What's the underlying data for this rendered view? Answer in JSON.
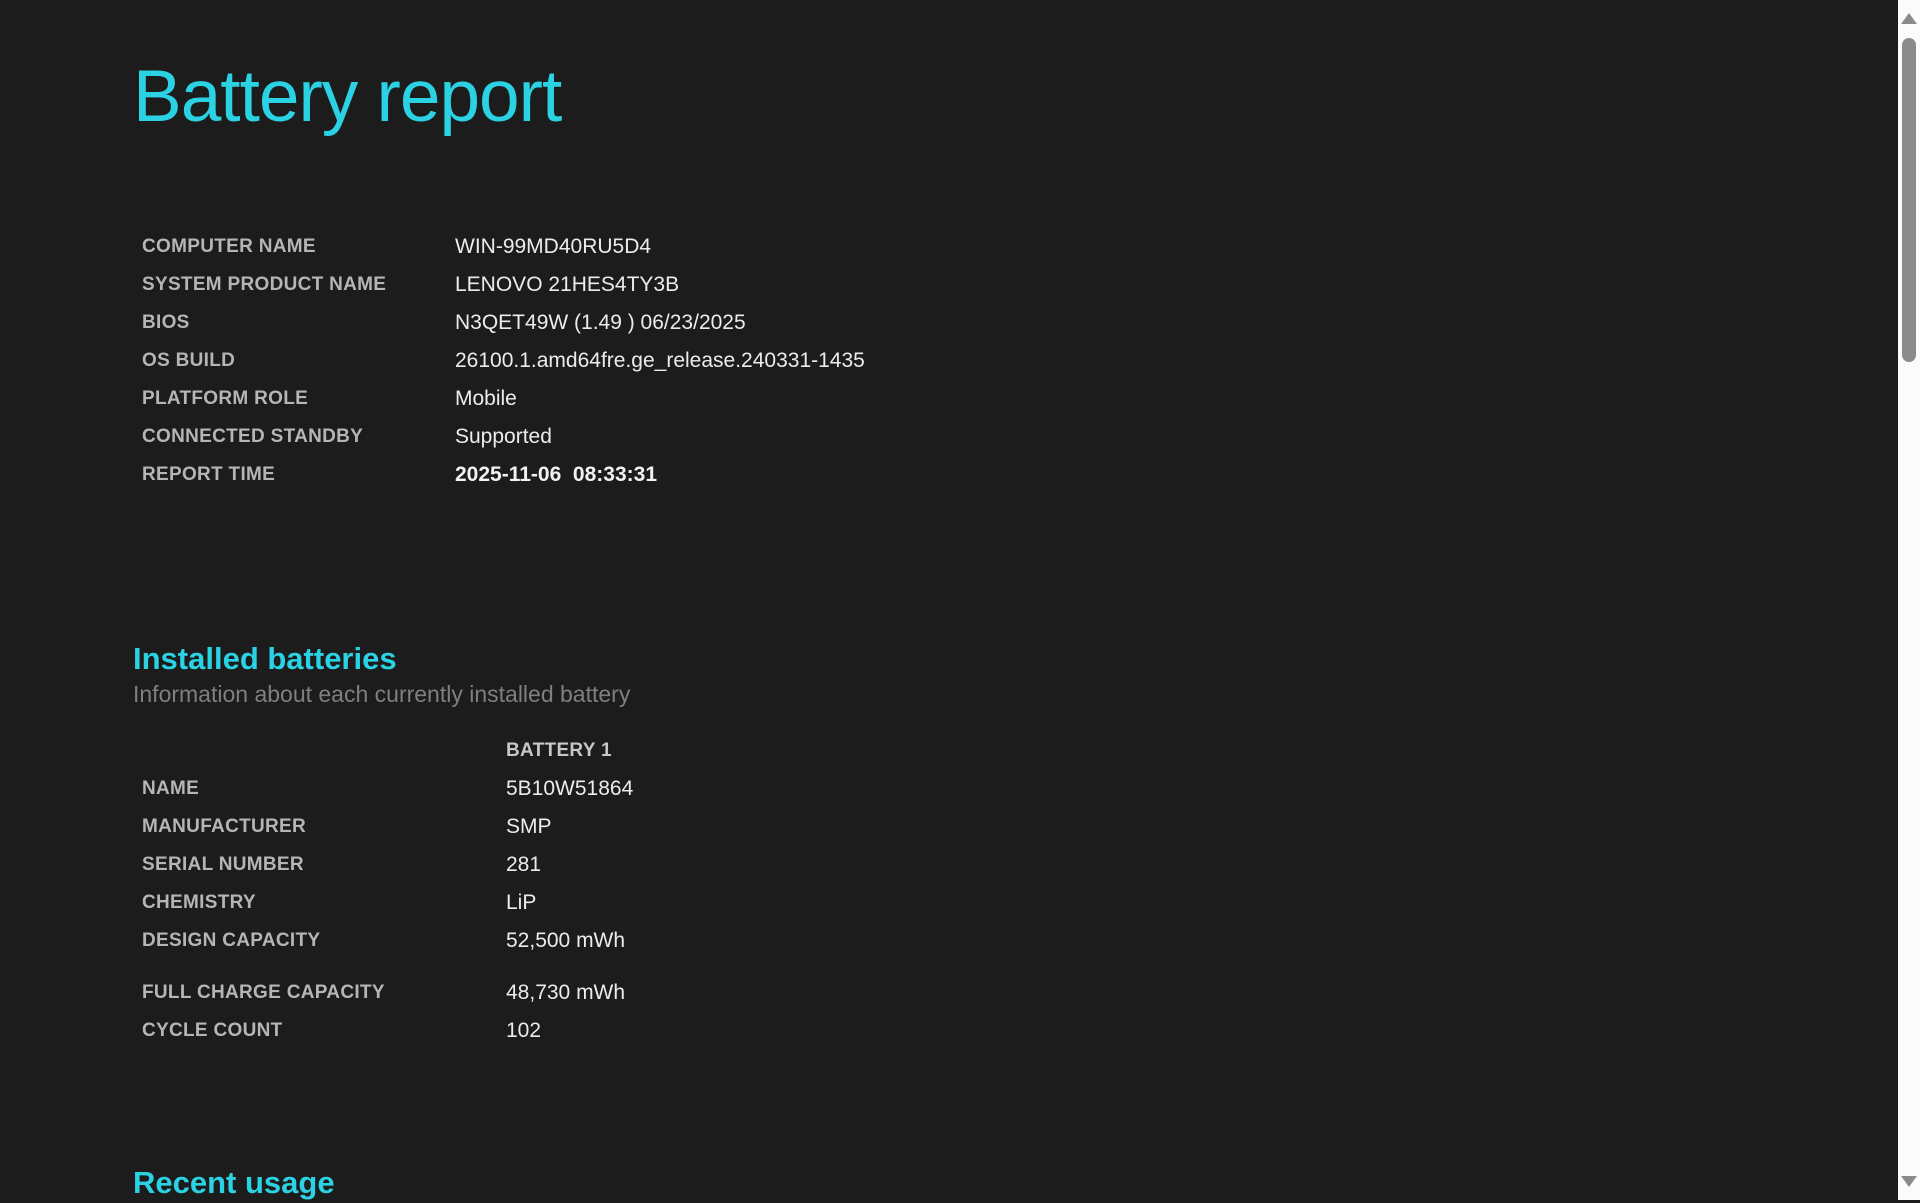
{
  "page_title": "Battery report",
  "colors": {
    "background": "#1c1c1c",
    "accent_cyan": "#2bd2e3",
    "label_gray": "#b5b5b5",
    "value_light": "#ececec"
  },
  "system_info": {
    "rows": [
      {
        "label": "COMPUTER NAME",
        "value": "WIN-99MD40RU5D4"
      },
      {
        "label": "SYSTEM PRODUCT NAME",
        "value": "LENOVO 21HES4TY3B"
      },
      {
        "label": "BIOS",
        "value": "N3QET49W (1.49 ) 06/23/2025"
      },
      {
        "label": "OS BUILD",
        "value": "26100.1.amd64fre.ge_release.240331-1435"
      },
      {
        "label": "PLATFORM ROLE",
        "value": "Mobile"
      },
      {
        "label": "CONNECTED STANDBY",
        "value": "Supported"
      },
      {
        "label": "REPORT TIME",
        "value": "2025-11-06  08:33:31"
      }
    ]
  },
  "installed_batteries": {
    "heading": "Installed batteries",
    "subtitle": "Information about each currently installed battery",
    "column_header": "BATTERY 1",
    "rows": [
      {
        "label": "NAME",
        "value": "5B10W51864"
      },
      {
        "label": "MANUFACTURER",
        "value": "SMP"
      },
      {
        "label": "SERIAL NUMBER",
        "value": "281"
      },
      {
        "label": "CHEMISTRY",
        "value": "LiP"
      },
      {
        "label": "DESIGN CAPACITY",
        "value": "52,500 mWh"
      },
      {
        "label": "FULL CHARGE CAPACITY",
        "value": "48,730 mWh"
      },
      {
        "label": "CYCLE COUNT",
        "value": "102"
      }
    ]
  },
  "recent_usage": {
    "heading": "Recent usage"
  }
}
